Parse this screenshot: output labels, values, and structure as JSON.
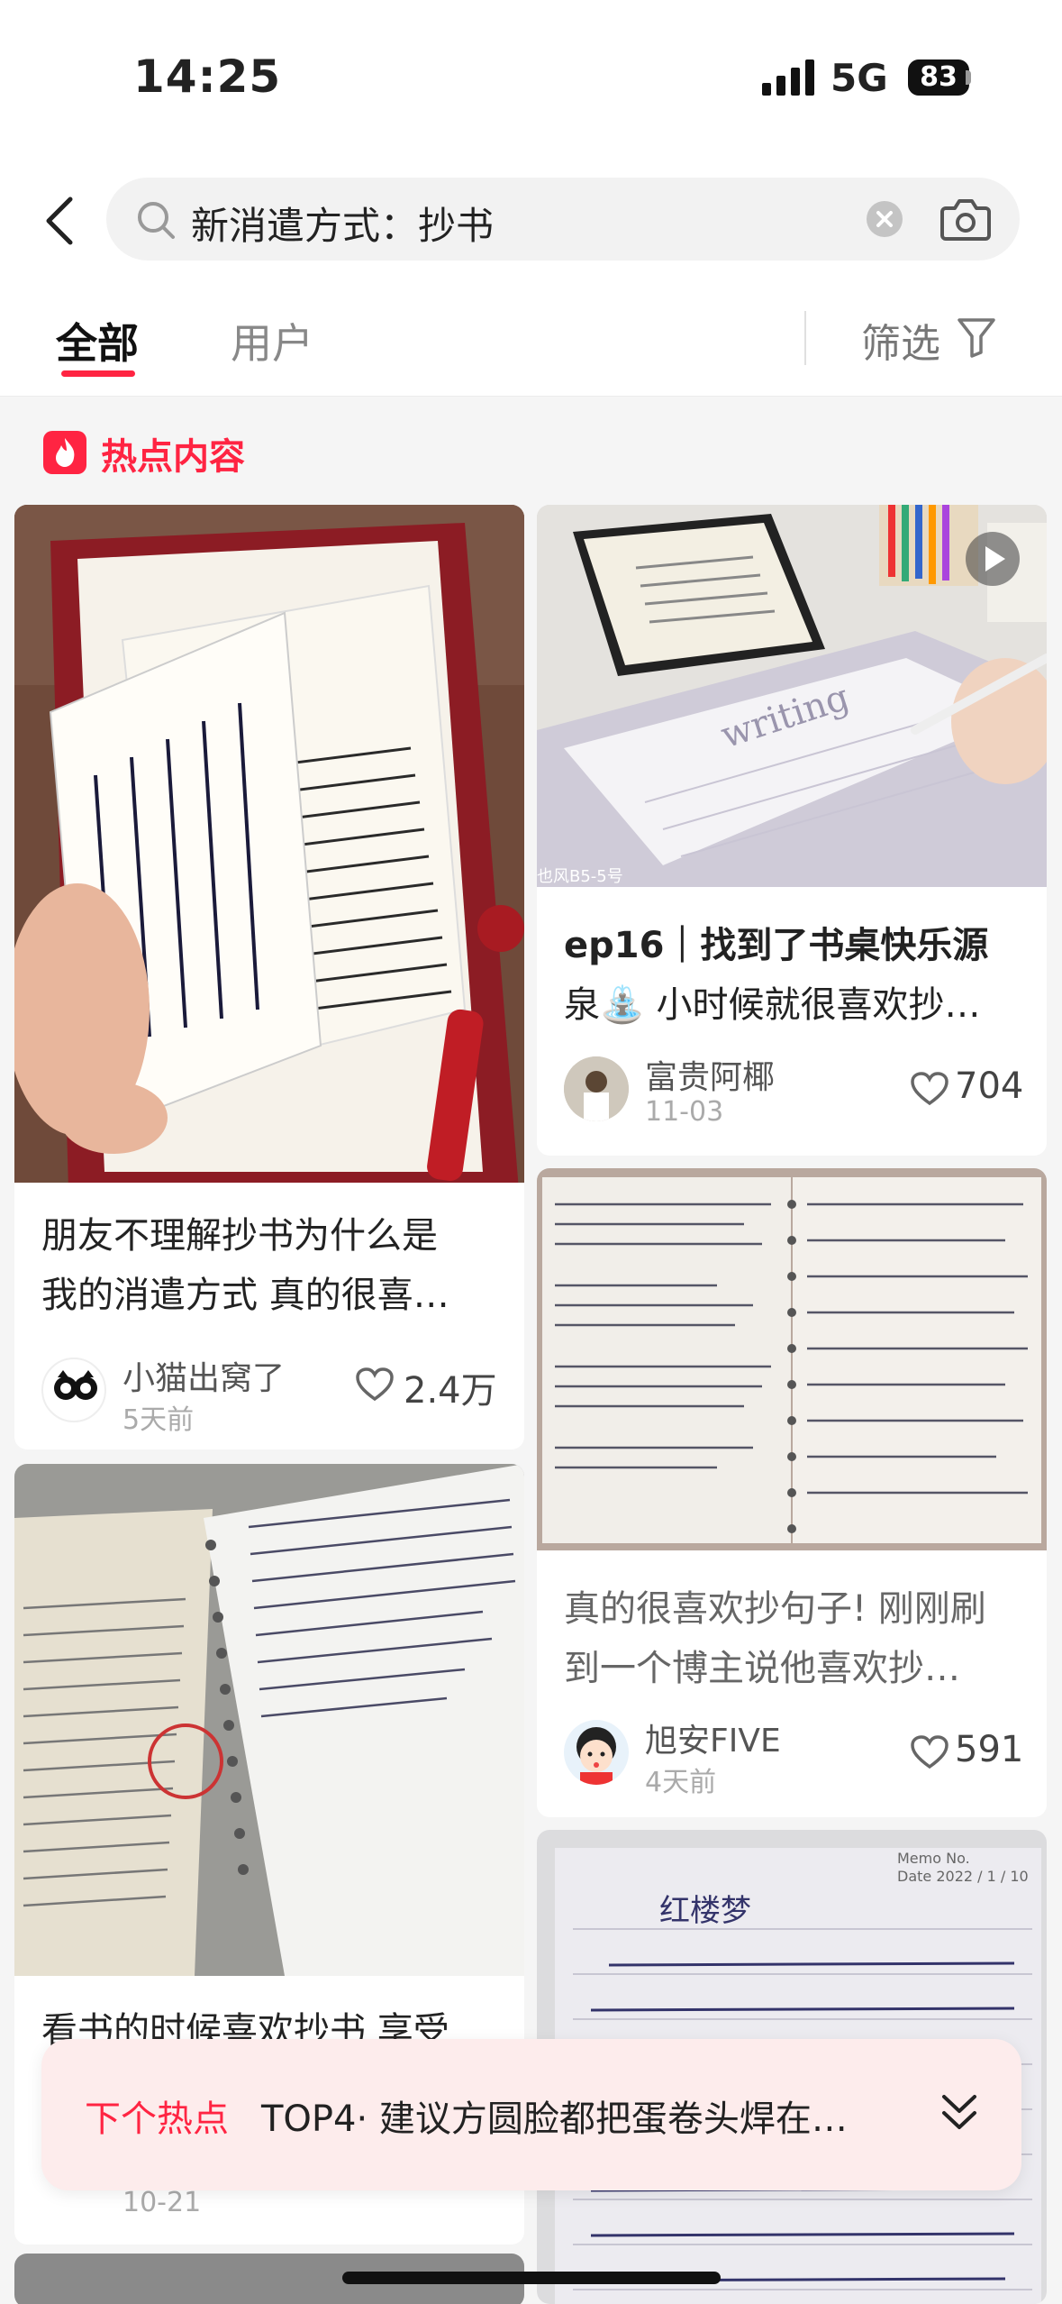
{
  "status_bar": {
    "time": "14:25",
    "network": "5G",
    "battery": "83"
  },
  "search": {
    "query": "新消遣方式：抄书"
  },
  "tabs": {
    "all": "全部",
    "user": "用户",
    "filter": "筛选"
  },
  "hot_section": {
    "title": "热点内容"
  },
  "cards": [
    {
      "title_line1": "朋友不理解抄书为什么是",
      "title_line2": "我的消遣方式 真的很喜…",
      "author": "小猫出窝了",
      "date": "5天前",
      "likes": "2.4万"
    },
    {
      "title_line1": "ep16｜找到了书桌快乐源",
      "title_line2": "泉⛲ 小时候就很喜欢抄…",
      "author": "富贵阿椰",
      "date": "11-03",
      "likes": "704",
      "image_caption": "也风B5-5号"
    },
    {
      "title_line1": "真的很喜欢抄句子! 刚刚刷",
      "title_line2": "到一个博主说他喜欢抄…",
      "author": "旭安FIVE",
      "date": "4天前",
      "likes": "591"
    },
    {
      "title_line1": "看书的时候喜欢抄书 享受",
      "date": "10-21"
    },
    {
      "title_line1": "红楼梦",
      "memo": "Memo No.",
      "memo_date": "Date 2022 / 1 / 10"
    }
  ],
  "banner": {
    "tag": "下个热点",
    "text": "TOP4· 建议方圆脸都把蛋卷头焊在…"
  },
  "colors": {
    "accent": "#ff2442"
  }
}
